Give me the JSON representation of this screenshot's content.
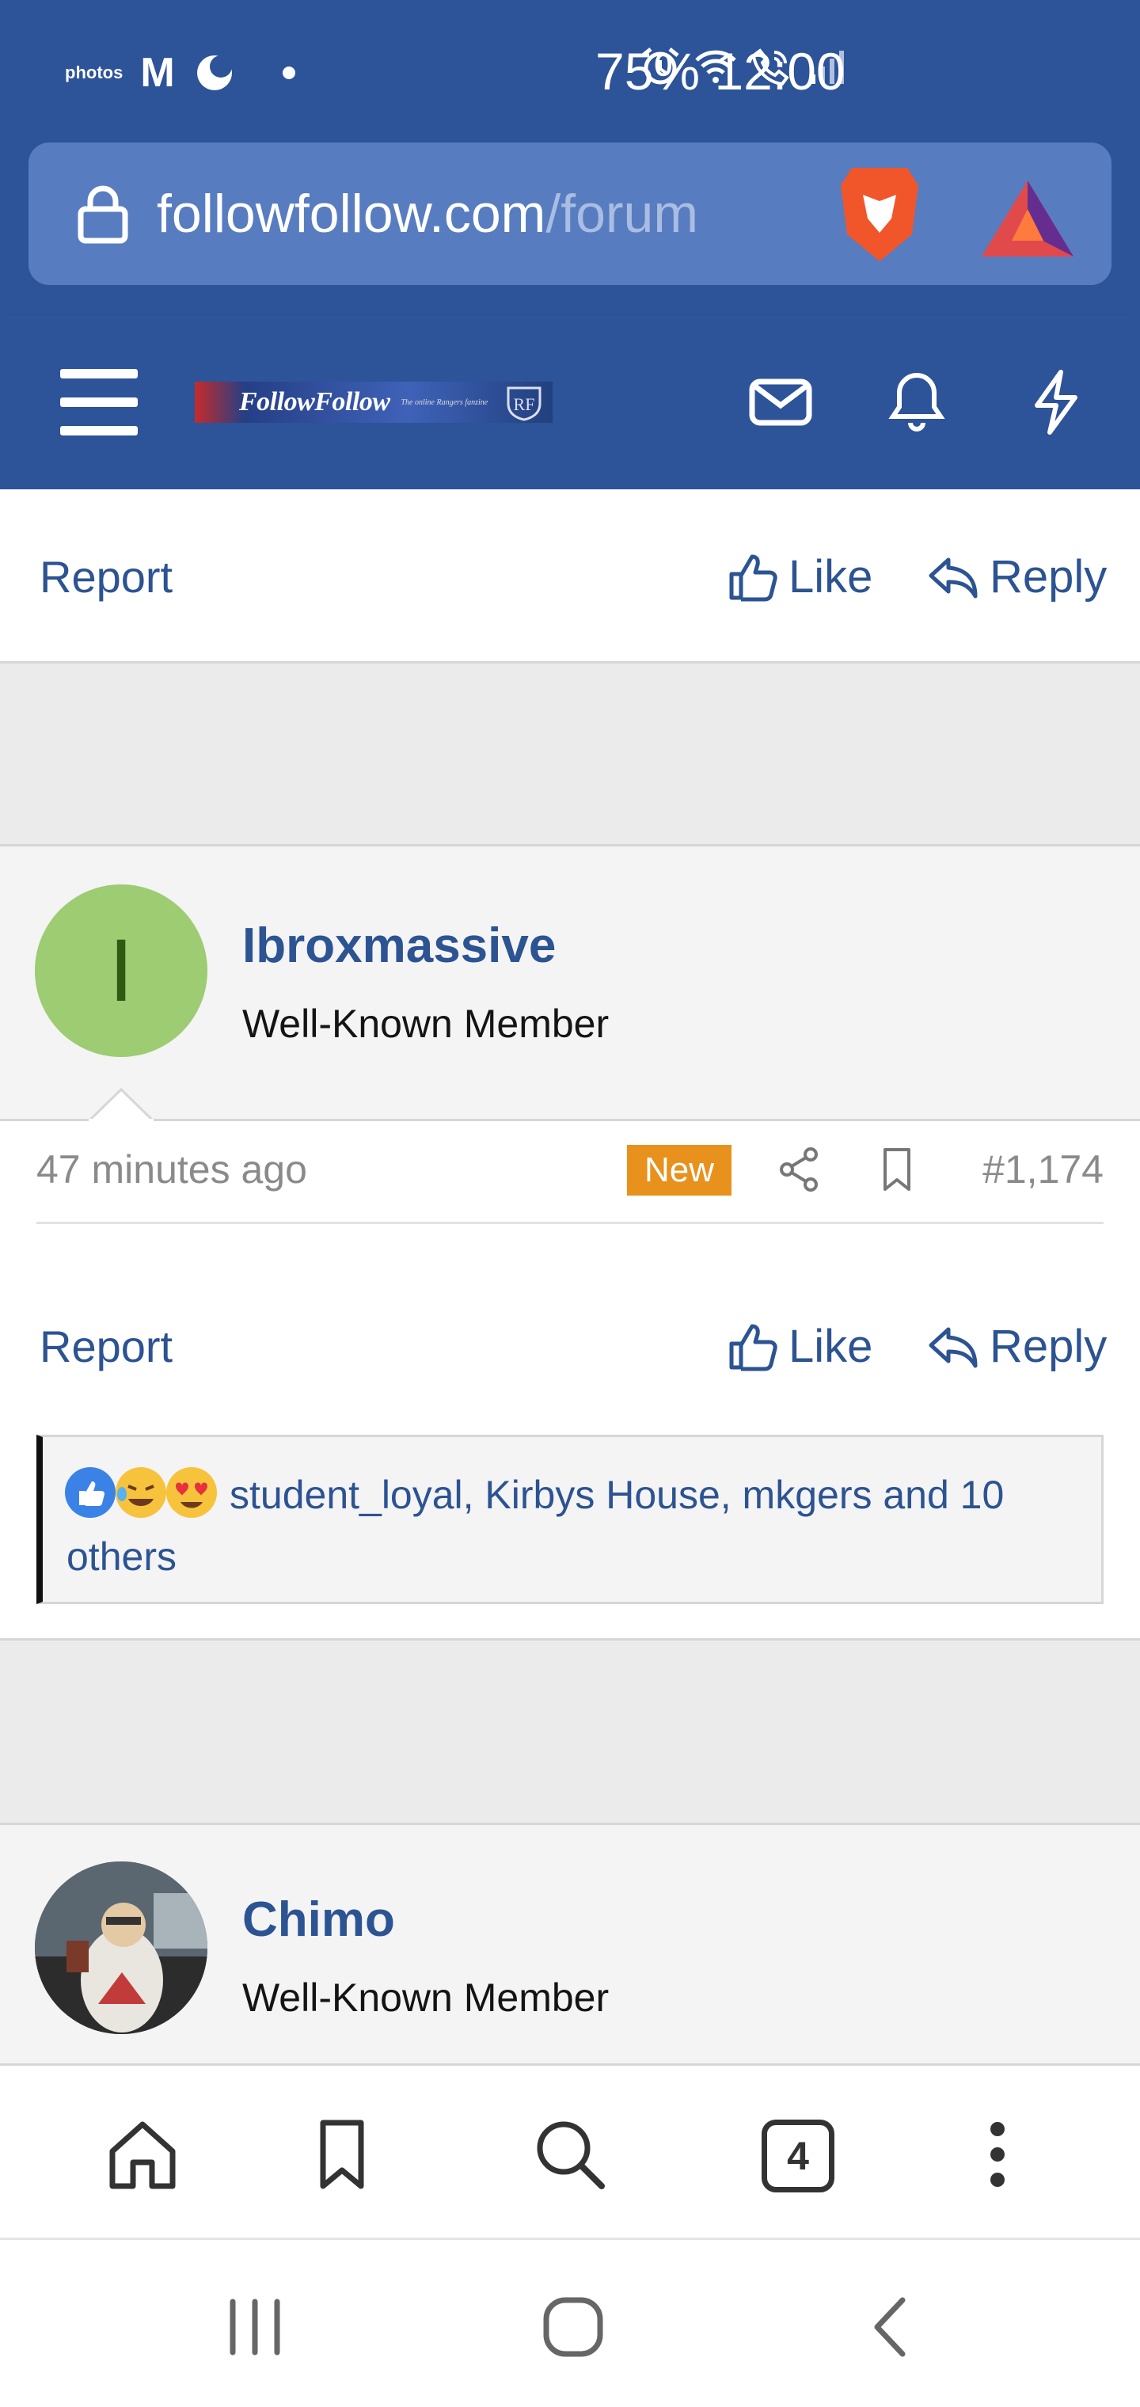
{
  "status_bar": {
    "photos_label": "photos",
    "gmail_glyph": "M",
    "battery": "75%",
    "time": "12:00",
    "icons": [
      "amazon-photos-icon",
      "gmail-icon",
      "moon-icon",
      "alarm-icon",
      "wifi-icon",
      "wifi-call-icon",
      "signal-icon"
    ]
  },
  "browser": {
    "url_domain": "followfollow.com",
    "url_path": "/forum",
    "icons": [
      "lock-icon",
      "brave-shields-icon",
      "brave-rewards-icon"
    ]
  },
  "forum_header": {
    "logo_text": "FollowFollow",
    "logo_subtext": "The online Rangers fanzine",
    "icons": [
      "hamburger-menu-icon",
      "mail-icon",
      "bell-icon",
      "bolt-icon"
    ]
  },
  "post_prev": {
    "report": "Report",
    "like": "Like",
    "reply": "Reply"
  },
  "post_1174": {
    "avatar_letter": "I",
    "username": "Ibroxmassive",
    "user_title": "Well-Known Member",
    "time_ago": "47 minutes ago",
    "badge": "New",
    "post_number": "#1,174",
    "report": "Report",
    "like": "Like",
    "reply": "Reply",
    "reactions_text": "student_loyal, Kirbys House, mkgers and 10 others",
    "reaction_icons": [
      "like-reaction-icon",
      "laugh-reaction-icon",
      "love-reaction-icon"
    ]
  },
  "post_next": {
    "username": "Chimo",
    "user_title": "Well-Known Member"
  },
  "toolbar": {
    "tab_count": "4",
    "icons": [
      "home-icon",
      "bookmark-icon",
      "search-icon",
      "tabs-icon",
      "more-icon"
    ]
  },
  "system_nav": {
    "icons": [
      "recent-apps-icon",
      "home-button-icon",
      "back-icon"
    ]
  },
  "colors": {
    "brand_blue": "#2d5399",
    "url_bar": "#587cc0",
    "link": "#2c5392",
    "new_badge": "#e8911d",
    "avatar_green": "#9dcc73"
  }
}
